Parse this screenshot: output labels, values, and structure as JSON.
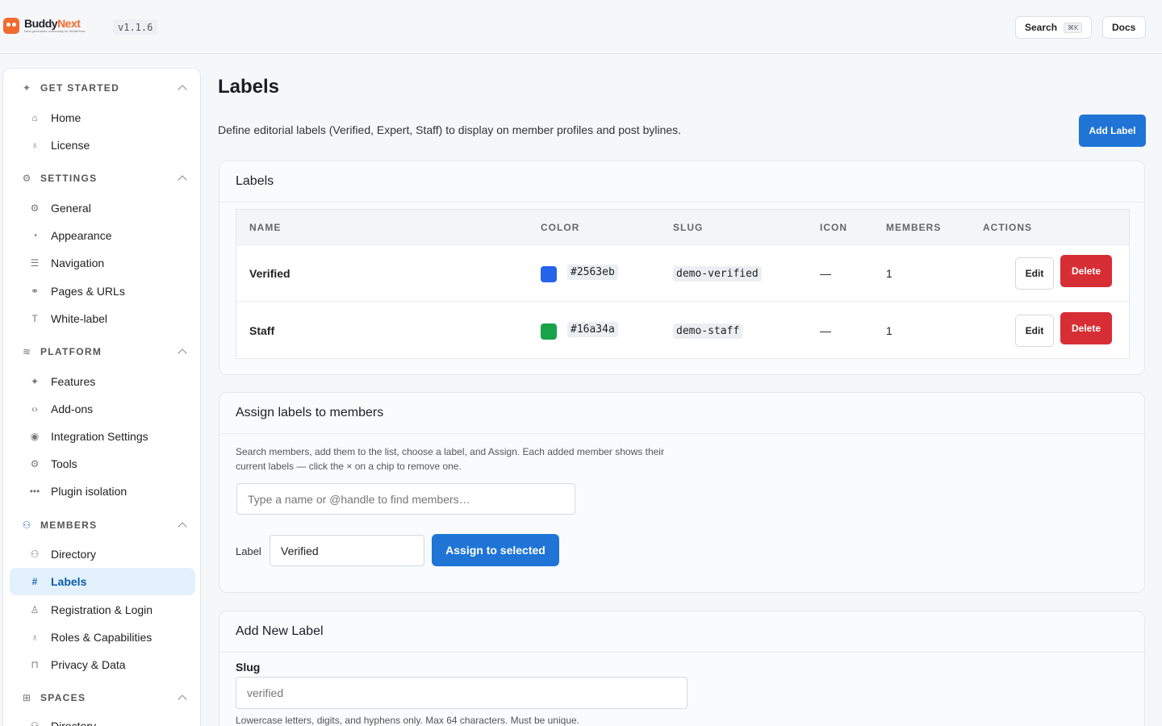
{
  "header": {
    "logo_name_1": "Buddy",
    "logo_name_2": "Next",
    "logo_tagline": "Next-generation community for WordPress",
    "version": "v1.1.6",
    "search_label": "Search",
    "search_shortcut": "⌘K",
    "docs_label": "Docs"
  },
  "sidebar": {
    "sections": [
      {
        "label": "GET STARTED",
        "icon": "sparkles-icon",
        "items": [
          {
            "label": "Home",
            "icon": "home-icon"
          },
          {
            "label": "License",
            "icon": "award-icon"
          }
        ]
      },
      {
        "label": "SETTINGS",
        "icon": "gear-icon",
        "items": [
          {
            "label": "General",
            "icon": "gear-icon"
          },
          {
            "label": "Appearance",
            "icon": "palette-icon"
          },
          {
            "label": "Navigation",
            "icon": "list-icon"
          },
          {
            "label": "Pages & URLs",
            "icon": "link-icon"
          },
          {
            "label": "White-label",
            "icon": "type-icon"
          }
        ]
      },
      {
        "label": "PLATFORM",
        "icon": "layers-icon",
        "items": [
          {
            "label": "Features",
            "icon": "sparkles-icon"
          },
          {
            "label": "Add-ons",
            "icon": "code-icon"
          },
          {
            "label": "Integration Settings",
            "icon": "eye-icon"
          },
          {
            "label": "Tools",
            "icon": "tool-icon"
          },
          {
            "label": "Plugin isolation",
            "icon": "dots-icon"
          }
        ]
      },
      {
        "label": "MEMBERS",
        "icon": "users-icon",
        "items": [
          {
            "label": "Directory",
            "icon": "users-icon"
          },
          {
            "label": "Labels",
            "icon": "hash-icon",
            "active": true
          },
          {
            "label": "Registration & Login",
            "icon": "user-icon"
          },
          {
            "label": "Roles & Capabilities",
            "icon": "award-icon"
          },
          {
            "label": "Privacy & Data",
            "icon": "lock-icon"
          }
        ]
      },
      {
        "label": "SPACES",
        "icon": "grid-icon",
        "items": [
          {
            "label": "Directory",
            "icon": "users-icon"
          }
        ]
      }
    ]
  },
  "main": {
    "title": "Labels",
    "description": "Define editorial labels (Verified, Expert, Staff) to display on member profiles and post bylines.",
    "add_label_button": "Add Label"
  },
  "labels_card": {
    "title": "Labels",
    "columns": [
      "NAME",
      "COLOR",
      "SLUG",
      "ICON",
      "MEMBERS",
      "ACTIONS"
    ],
    "rows": [
      {
        "name": "Verified",
        "color": "#2563eb",
        "slug": "demo-verified",
        "icon": "—",
        "members": "1"
      },
      {
        "name": "Staff",
        "color": "#16a34a",
        "slug": "demo-staff",
        "icon": "—",
        "members": "1"
      }
    ],
    "edit_label": "Edit",
    "delete_label": "Delete"
  },
  "assign_card": {
    "title": "Assign labels to members",
    "help_text": "Search members, add them to the list, choose a label, and Assign. Each added member shows their current labels — click the × on a chip to remove one.",
    "search_placeholder": "Type a name or @handle to find members…",
    "label_field_label": "Label",
    "label_value": "Verified",
    "assign_button": "Assign to selected"
  },
  "new_label_card": {
    "title": "Add New Label",
    "slug_label": "Slug",
    "slug_placeholder": "verified",
    "slug_help": "Lowercase letters, digits, and hyphens only. Max 64 characters. Must be unique."
  },
  "colors": {
    "accent": "#1f74d6",
    "danger": "#d72e35",
    "brand": "#f26a2e",
    "active_bg": "#e2f1fd"
  }
}
